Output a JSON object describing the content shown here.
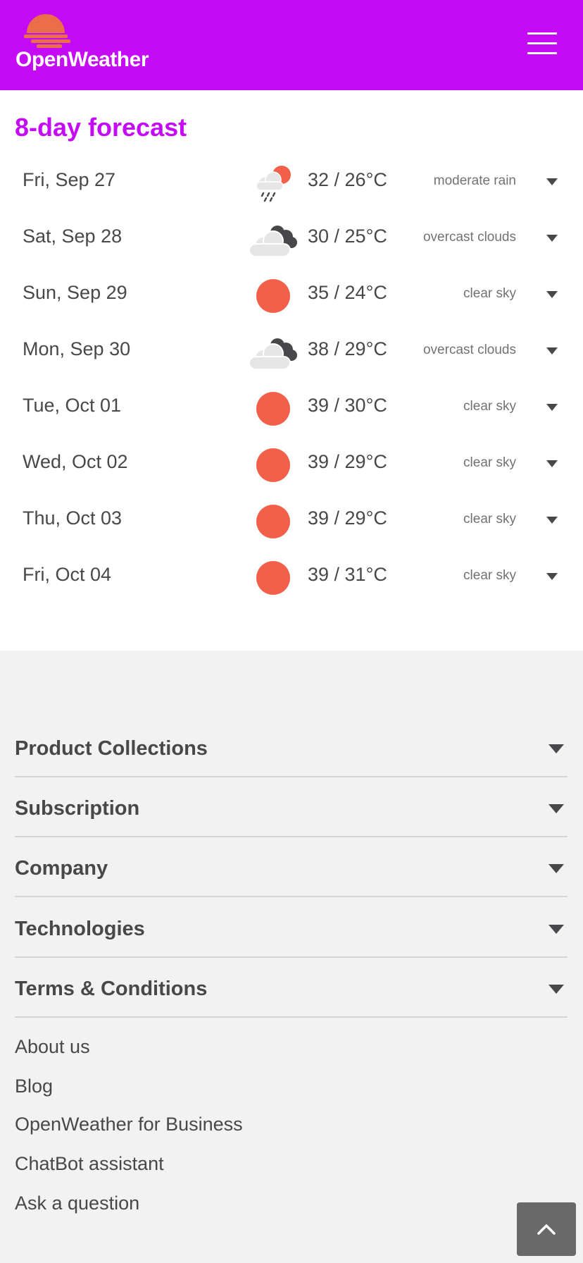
{
  "header": {
    "logo_text": "OpenWeather",
    "menu_icon": "hamburger-menu-icon",
    "brand_color": "#c50af5"
  },
  "forecast": {
    "title": "8-day forecast",
    "days": [
      {
        "date": "Fri, Sep 27",
        "icon": "rain-sun-icon",
        "temp": "32 / 26°C",
        "desc": "moderate rain"
      },
      {
        "date": "Sat, Sep 28",
        "icon": "overcast-clouds-icon",
        "temp": "30 / 25°C",
        "desc": "overcast clouds"
      },
      {
        "date": "Sun, Sep 29",
        "icon": "clear-sky-icon",
        "temp": "35 / 24°C",
        "desc": "clear sky"
      },
      {
        "date": "Mon, Sep 30",
        "icon": "overcast-clouds-icon",
        "temp": "38 / 29°C",
        "desc": "overcast clouds"
      },
      {
        "date": "Tue, Oct 01",
        "icon": "clear-sky-icon",
        "temp": "39 / 30°C",
        "desc": "clear sky"
      },
      {
        "date": "Wed, Oct 02",
        "icon": "clear-sky-icon",
        "temp": "39 / 29°C",
        "desc": "clear sky"
      },
      {
        "date": "Thu, Oct 03",
        "icon": "clear-sky-icon",
        "temp": "39 / 29°C",
        "desc": "clear sky"
      },
      {
        "date": "Fri, Oct 04",
        "icon": "clear-sky-icon",
        "temp": "39 / 31°C",
        "desc": "clear sky"
      }
    ]
  },
  "footer": {
    "sections": [
      {
        "label": "Product Collections"
      },
      {
        "label": "Subscription"
      },
      {
        "label": "Company"
      },
      {
        "label": "Technologies"
      },
      {
        "label": "Terms & Conditions"
      }
    ],
    "links": [
      {
        "label": "About us"
      },
      {
        "label": "Blog"
      },
      {
        "label": "OpenWeather for Business"
      },
      {
        "label": "ChatBot assistant"
      },
      {
        "label": "Ask a question"
      }
    ],
    "scroll_top_icon": "chevron-up-icon"
  },
  "colors": {
    "sun": "#f2604a",
    "cloud_light": "#e6e6e6",
    "cloud_dark": "#48484a"
  }
}
